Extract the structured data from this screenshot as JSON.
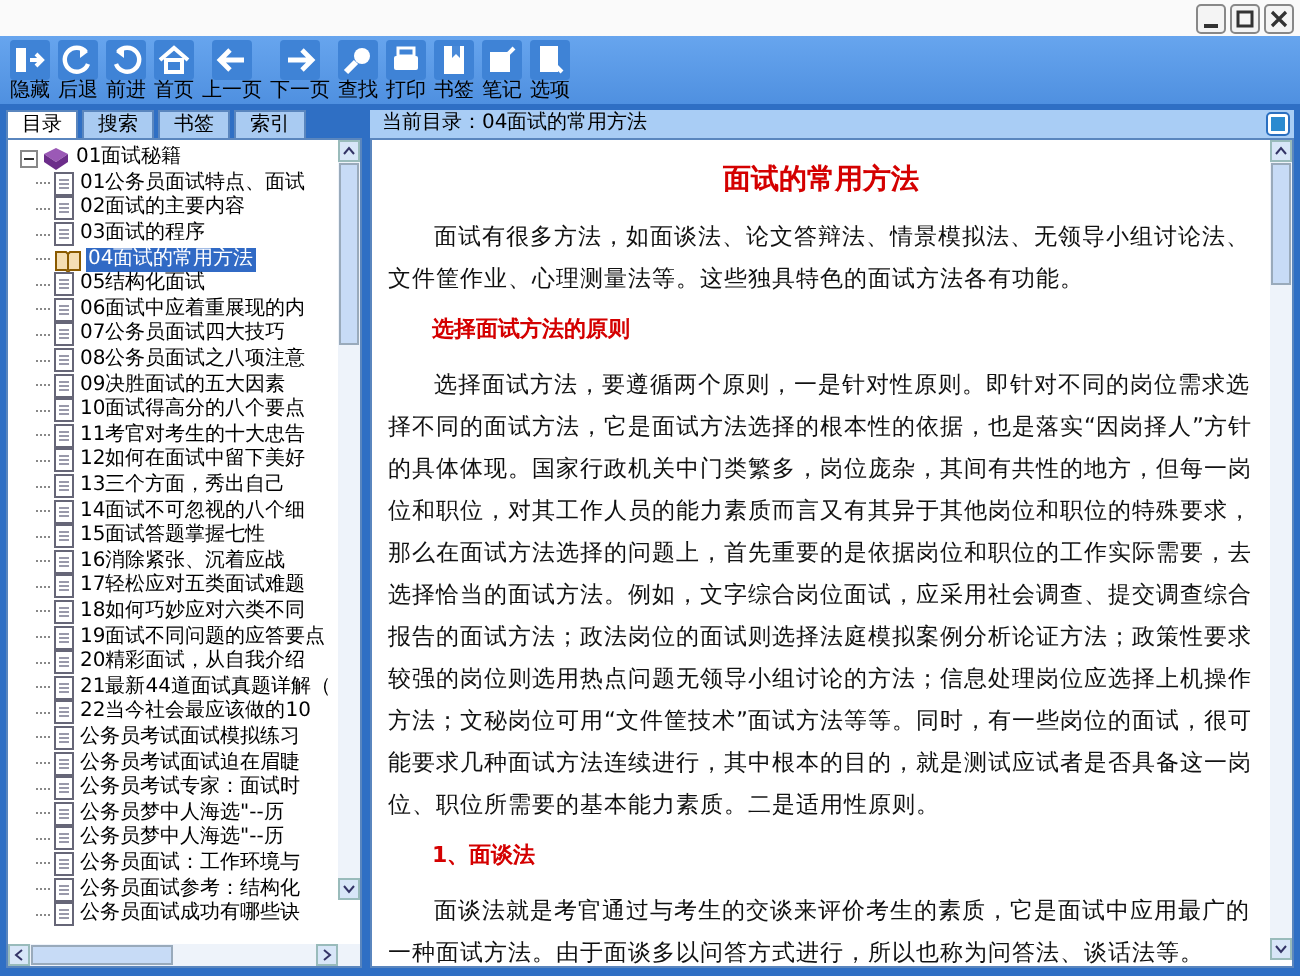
{
  "toolbar": [
    {
      "label": "隐藏",
      "kind": "hide"
    },
    {
      "label": "后退",
      "kind": "back"
    },
    {
      "label": "前进",
      "kind": "forward"
    },
    {
      "label": "首页",
      "kind": "home"
    },
    {
      "label": "上一页",
      "kind": "prev"
    },
    {
      "label": "下一页",
      "kind": "next"
    },
    {
      "label": "查找",
      "kind": "find"
    },
    {
      "label": "打印",
      "kind": "print"
    },
    {
      "label": "书签",
      "kind": "bookmark"
    },
    {
      "label": "笔记",
      "kind": "note"
    },
    {
      "label": "选项",
      "kind": "options"
    }
  ],
  "tabs": [
    {
      "label": "目录",
      "selected": true
    },
    {
      "label": "搜索",
      "selected": false
    },
    {
      "label": "书签",
      "selected": false
    },
    {
      "label": "索引",
      "selected": false
    }
  ],
  "tree": {
    "label": "01面试秘籍",
    "expanded": true,
    "children": [
      {
        "label": "01公务员面试特点、面试",
        "selected": false
      },
      {
        "label": "02面试的主要内容",
        "selected": false
      },
      {
        "label": "03面试的程序",
        "selected": false
      },
      {
        "label": "04面试的常用方法",
        "selected": true
      },
      {
        "label": "05结构化面试",
        "selected": false
      },
      {
        "label": "06面试中应着重展现的内",
        "selected": false
      },
      {
        "label": "07公务员面试四大技巧",
        "selected": false
      },
      {
        "label": "08公务员面试之八项注意",
        "selected": false
      },
      {
        "label": "09决胜面试的五大因素",
        "selected": false
      },
      {
        "label": "10面试得高分的八个要点",
        "selected": false
      },
      {
        "label": "11考官对考生的十大忠告",
        "selected": false
      },
      {
        "label": "12如何在面试中留下美好",
        "selected": false
      },
      {
        "label": "13三个方面，秀出自己",
        "selected": false
      },
      {
        "label": "14面试不可忽视的八个细",
        "selected": false
      },
      {
        "label": "15面试答题掌握七性",
        "selected": false
      },
      {
        "label": "16消除紧张、沉着应战",
        "selected": false
      },
      {
        "label": "17轻松应对五类面试难题",
        "selected": false
      },
      {
        "label": "18如何巧妙应对六类不同",
        "selected": false
      },
      {
        "label": "19面试不同问题的应答要点",
        "selected": false
      },
      {
        "label": "20精彩面试，从自我介绍",
        "selected": false
      },
      {
        "label": "21最新44道面试真题详解（",
        "selected": false
      },
      {
        "label": "22当今社会最应该做的10",
        "selected": false
      },
      {
        "label": "公务员考试面试模拟练习",
        "selected": false
      },
      {
        "label": "公务员考试面试迫在眉睫",
        "selected": false
      },
      {
        "label": "公务员考试专家：面试时",
        "selected": false
      },
      {
        "label": "公务员梦中人海选\"--历",
        "selected": false
      },
      {
        "label": "公务员梦中人海选\"--历",
        "selected": false
      },
      {
        "label": "公务员面试：工作环境与",
        "selected": false
      },
      {
        "label": "公务员面试参考：结构化",
        "selected": false
      },
      {
        "label": "公务员面试成功有哪些诀",
        "selected": false
      }
    ]
  },
  "content": {
    "current": "当前目录：04面试的常用方法",
    "title": "面试的常用方法",
    "blocks": [
      {
        "kind": "paragraph",
        "text": "面试有很多方法，如面谈法、论文答辩法、情景模拟法、无领导小组讨论法、文件筐作业、心理测量法等。这些独具特色的面试方法各有功能。"
      },
      {
        "kind": "heading",
        "text": "选择面试方法的原则"
      },
      {
        "kind": "paragraph",
        "text": "选择面试方法，要遵循两个原则，一是针对性原则。即针对不同的岗位需求选择不同的面试方法，它是面试方法选择的根本性的依据，也是落实“因岗择人”方针的具体体现。国家行政机关中门类繁多，岗位庞杂，其间有共性的地方，但每一岗位和职位，对其工作人员的能力素质而言又有其异于其他岗位和职位的特殊要求，那么在面试方法选择的问题上，首先重要的是依据岗位和职位的工作实际需要，去选择恰当的面试方法。例如，文字综合岗位面试，应采用社会调查、提交调查综合报告的面试方法；政法岗位的面试则选择法庭模拟案例分析论证方法；政策性要求较强的岗位则选用热点问题无领导小组讨论的方法；信息处理岗位应选择上机操作方法；文秘岗位可用“文件筐技术”面试方法等等。同时，有一些岗位的面试，很可能要求几种面试方法连续进行，其中根本的目的，就是测试应试者是否具备这一岗位、职位所需要的基本能力素质。二是适用性原则。"
      },
      {
        "kind": "heading",
        "text": "1、面谈法"
      },
      {
        "kind": "paragraph",
        "text": "面谈法就是考官通过与考生的交谈来评价考生的素质，它是面试中应用最广的一种面试方法。由于面谈多以问答方式进行，所以也称为问答法、谈话法等。"
      }
    ]
  }
}
